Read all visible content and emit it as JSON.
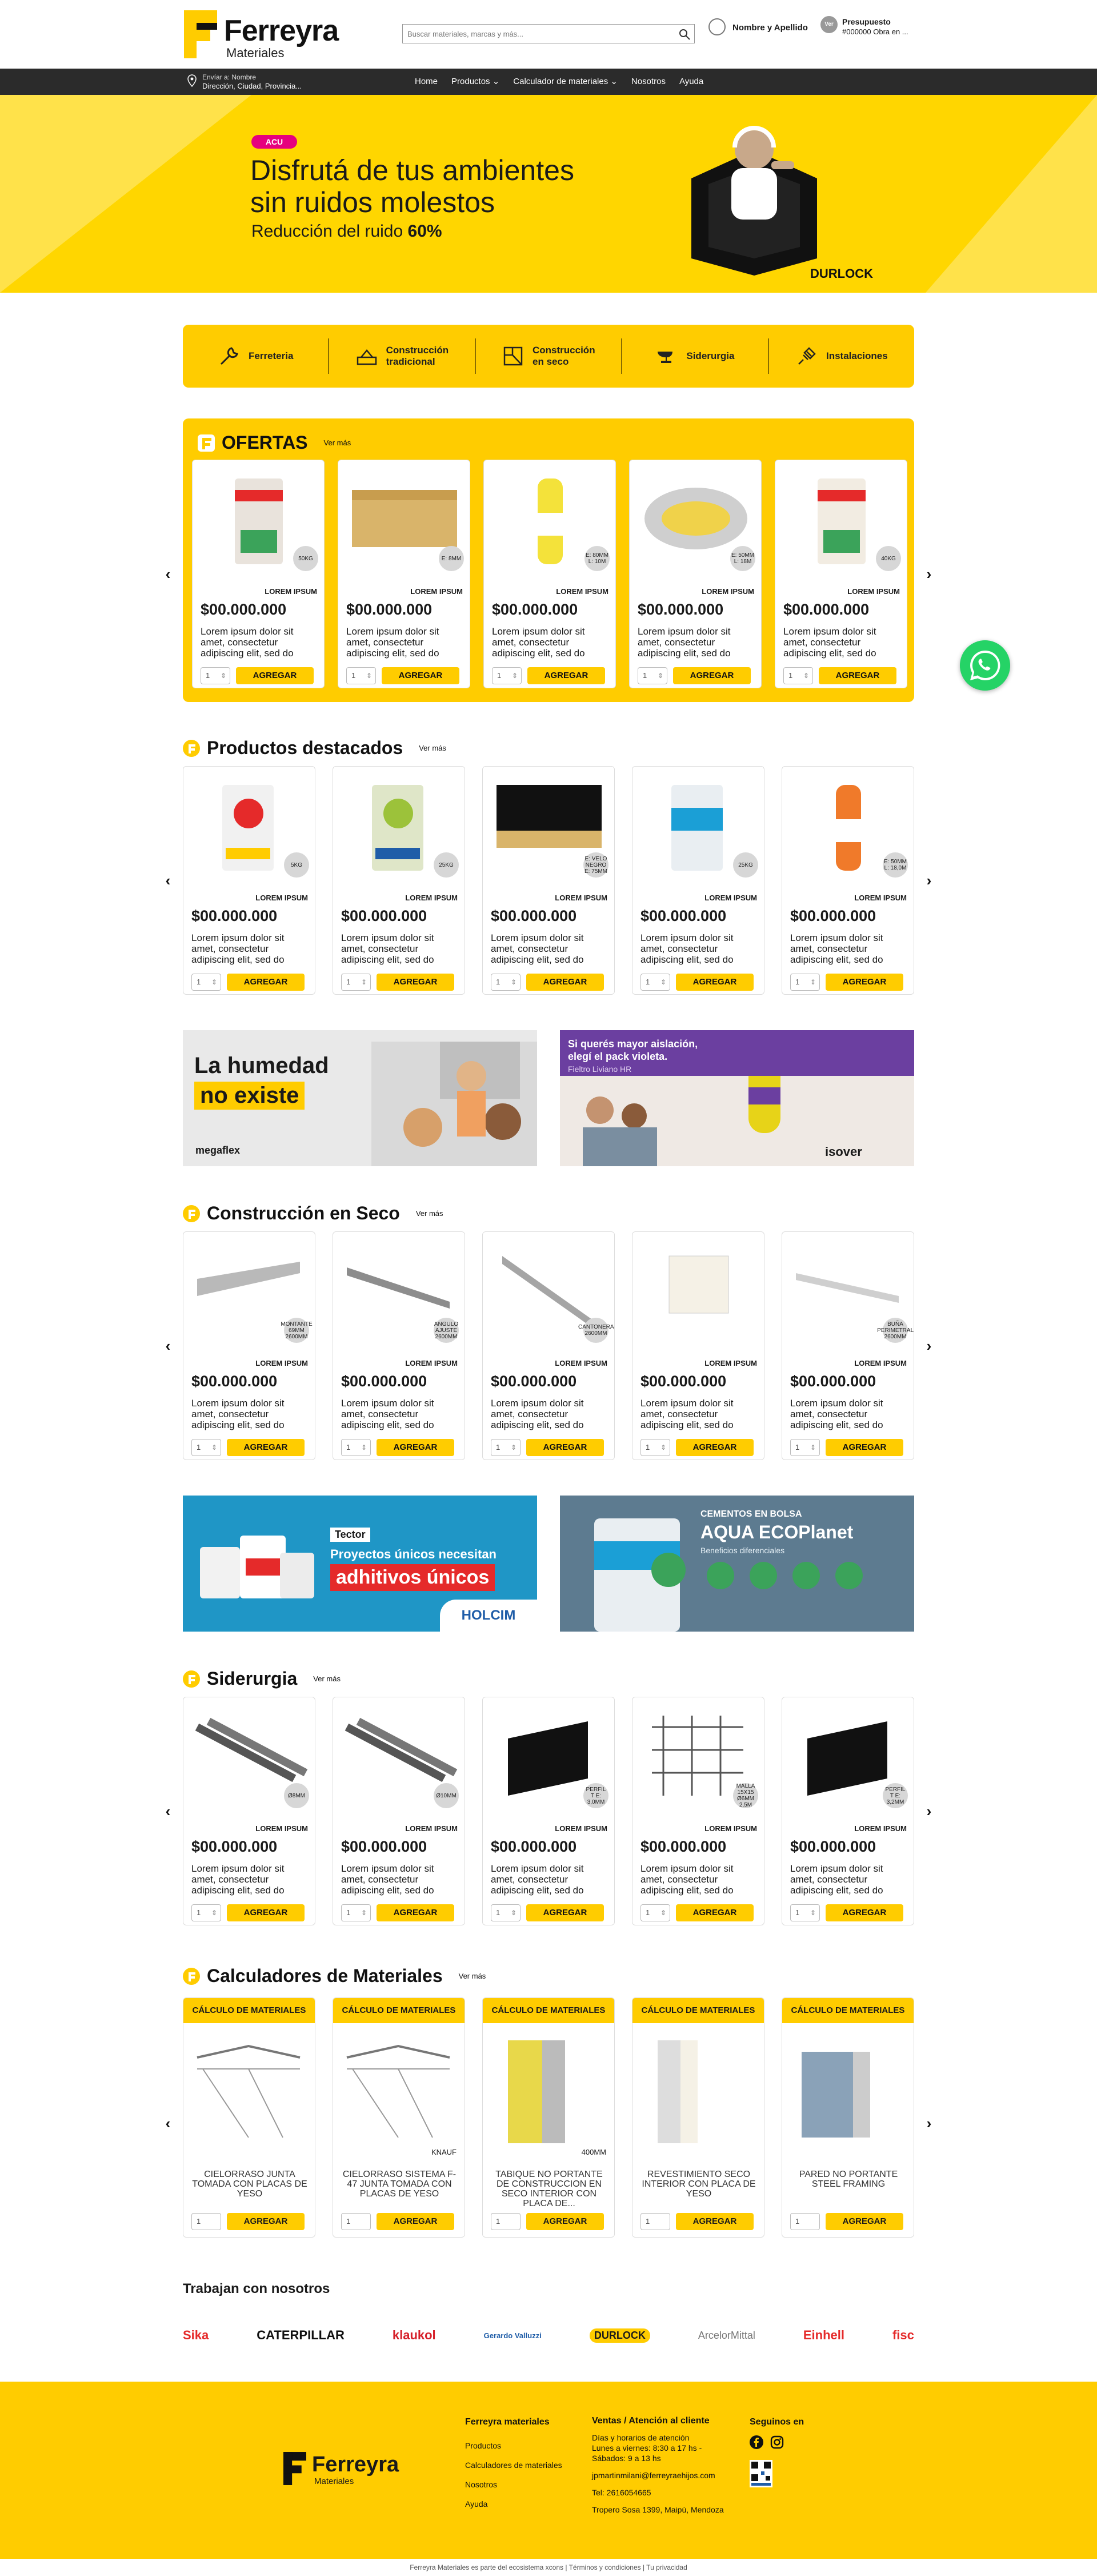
{
  "header": {
    "brand": "Ferreyra",
    "brand_sub": "Materiales",
    "search_placeholder": "Buscar materiales, marcas y más...",
    "user_label": "Nombre y Apellido",
    "budget_title": "Presupuesto",
    "budget_sub": "#000000 Obra en ...",
    "budget_badge": "Ver"
  },
  "nav": {
    "ship_line1": "Envíar a: Nombre",
    "ship_line2": "Dirección, Ciudad, Provincia...",
    "links": [
      "Home",
      "Productos ⌄",
      "Calculador de materiales ⌄",
      "Nosotros",
      "Ayuda"
    ]
  },
  "hero": {
    "badge": "ACU",
    "line1": "Disfrutá de tus ambientes",
    "line2": "sin ruidos molestos",
    "line3": "Reducción del ruido",
    "line3_bold": "60%",
    "brand": "DURLOCK"
  },
  "categories": [
    {
      "label": "Ferreteria",
      "icon": "wrench-icon"
    },
    {
      "label": "Construcción tradicional",
      "icon": "trowel-icon"
    },
    {
      "label": "Construcción en seco",
      "icon": "drywall-icon"
    },
    {
      "label": "Siderurgia",
      "icon": "anvil-icon"
    },
    {
      "label": "Instalaciones",
      "icon": "plug-icon"
    }
  ],
  "common": {
    "brand": "LOREM IPSUM",
    "price": "$00.000.000",
    "desc": "Lorem ipsum dolor sit amet, consectetur adipiscing elit, sed do eiusmod tempor",
    "qty": "1",
    "add": "AGREGAR"
  },
  "offers": {
    "title": "OFERTAS",
    "more": "Ver más",
    "tags": [
      "50KG",
      "E: 8MM",
      "E: 80MM L: 10M",
      "E: 50MM L: 18M",
      "40KG"
    ]
  },
  "featured": {
    "title": "Productos destacados",
    "more": "Ver más",
    "tags": [
      "5KG",
      "25KG",
      "E: VELO NEGRO E: 75MM",
      "25KG",
      "E: 50MM L: 18,0M"
    ]
  },
  "banners1": {
    "left_l1": "La humedad",
    "left_l2": "no existe",
    "left_brand": "megaflex",
    "right_l1": "Si querés mayor aislación,",
    "right_l2": "elegí el pack violeta.",
    "right_l3": "Fieltro Liviano HR",
    "right_brand": "isover"
  },
  "seco": {
    "title": "Construcción en Seco",
    "more": "Ver más",
    "tags": [
      "MONTANTE 69MM 2600MM",
      "ANGULO AJUSTE 2600MM",
      "CANTONERA 2600MM",
      "",
      "BUÑA PERIMETRAL 2600MM"
    ]
  },
  "banners2": {
    "left_badge": "Tector",
    "left_l1": "Proyectos únicos necesitan",
    "left_l2": "adhitivos únicos",
    "left_brand": "HOLCIM",
    "right_l1": "CEMENTOS EN BOLSA",
    "right_l2": "AQUA ECOPlanet",
    "right_l3": "Beneficios diferenciales"
  },
  "siderurgia": {
    "title": "Siderurgia",
    "more": "Ver más",
    "tags": [
      "Ø8MM",
      "Ø10MM",
      "PERFIL T E: 3,0MM",
      "MALLA 15X15 Ø6MM 2,5M",
      "PERFIL T E: 3,2MM"
    ]
  },
  "calc": {
    "title": "Calculadores de Materiales",
    "more": "Ver más",
    "head": "CÁLCULO DE MATERIALES",
    "cards": [
      {
        "title": "CIELORRASO JUNTA TOMADA CON PLACAS DE YESO",
        "sub": ""
      },
      {
        "title": "CIELORRASO SISTEMA F-47 JUNTA TOMADA CON PLACAS DE YESO",
        "sub": "KNAUF"
      },
      {
        "title": "TABIQUE NO PORTANTE DE CONSTRUCCION EN SECO INTERIOR CON PLACA DE...",
        "sub": "400MM"
      },
      {
        "title": "REVESTIMIENTO SECO INTERIOR CON PLACA DE YESO",
        "sub": ""
      },
      {
        "title": "PARED NO PORTANTE STEEL FRAMING",
        "sub": ""
      }
    ]
  },
  "partners": {
    "title": "Trabajan con nosotros",
    "logos": [
      "Sika",
      "CATERPILLAR",
      "klaukol",
      "Gerardo Valluzzi",
      "DURLOCK",
      "ArcelorMittal",
      "Einhell",
      "fisc"
    ]
  },
  "footer": {
    "brand": "Ferreyra",
    "brand_sub": "Materiales",
    "col1_title": "Ferreyra materiales",
    "col1_links": [
      "Productos",
      "Calculadores de materiales",
      "Nosotros",
      "Ayuda"
    ],
    "col2_title": "Ventas / Atención al cliente",
    "col2_lines": [
      "Días y horarios de atención",
      "Lunes a viernes: 8:30 a 17 hs -",
      "Sábados: 9 a 13 hs",
      "jpmartinmilani@ferreyraehijos.com",
      "Tel: 2616054665",
      "Tropero Sosa 1399, Maipú, Mendoza"
    ],
    "col3_title": "Seguinos en"
  },
  "copyright": "Ferreyra Materiales es parte del ecosistema xcons  |  Términos y condiciones | Tu privacidad",
  "colors": {
    "brand_yellow": "#ffcc00",
    "dark": "#2b2b2b",
    "whatsapp": "#25d366"
  }
}
